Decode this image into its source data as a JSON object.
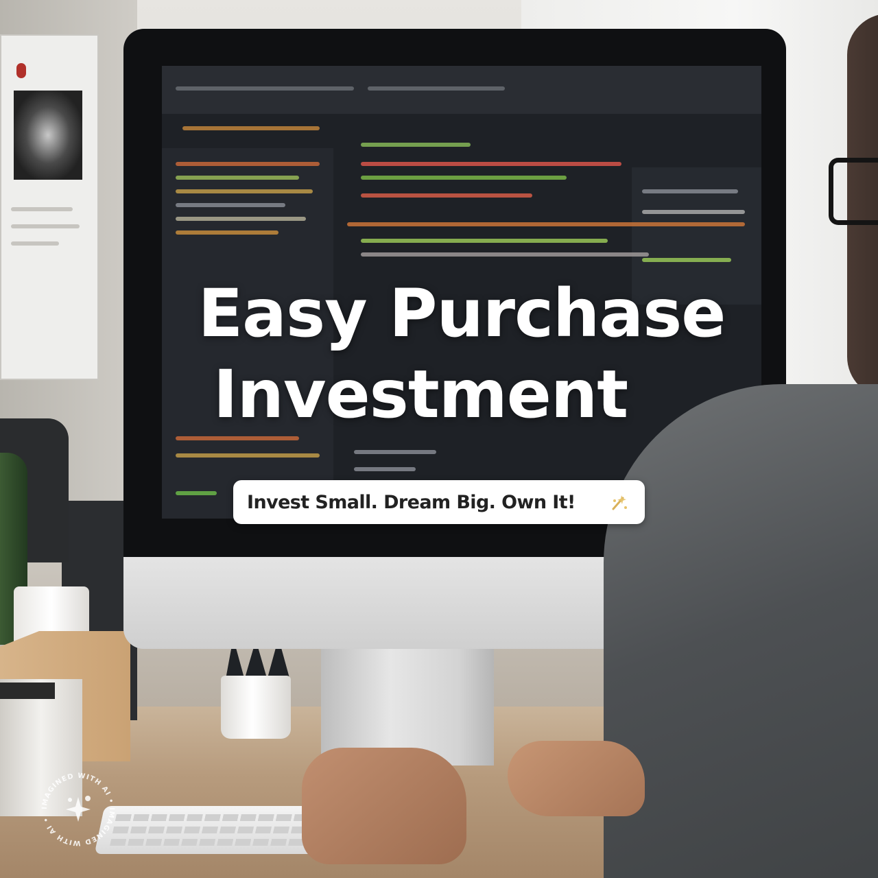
{
  "headline": {
    "line1": "Easy Purchase",
    "line2": "Investment"
  },
  "tagline": {
    "text": "Invest Small. Dream Big. Own It!",
    "icon": "sparkle-icon"
  },
  "watermark": {
    "text": "IMAGINED WITH AI • IMAGINED WITH AI •",
    "icon": "ai-sparkle-icon"
  },
  "colors": {
    "headline": "#ffffff",
    "pill_background": "#ffffff",
    "pill_text": "#222222",
    "screen": "#1e2126"
  }
}
